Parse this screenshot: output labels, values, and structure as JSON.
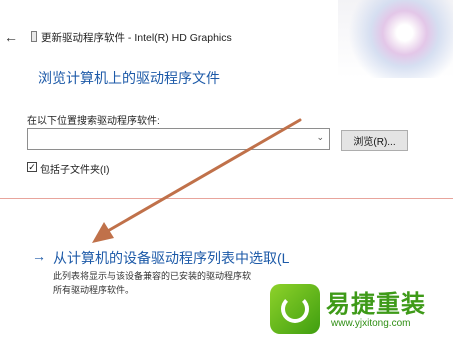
{
  "window": {
    "title": "更新驱动程序软件 - Intel(R) HD Graphics",
    "back_icon": "back-arrow-icon"
  },
  "page": {
    "heading": "浏览计算机上的驱动程序文件",
    "search_label": "在以下位置搜索驱动程序软件:",
    "path_value": "",
    "browse_label": "浏览(R)...",
    "include_subfolders_label": "包括子文件夹(I)",
    "include_subfolders_checked": true
  },
  "pick": {
    "arrow": "→",
    "link": "从计算机的设备驱动程序列表中选取(L",
    "description_line1": "此列表将显示与该设备兼容的已安装的驱动程序软",
    "description_line2": "所有驱动程序软件。"
  },
  "watermark": {
    "title": "易捷重装",
    "url": "www.yjxitong.com"
  },
  "colors": {
    "link_blue": "#1d5aa8",
    "annotation_arrow": "#c0714a",
    "logo_green": "#3e9a18"
  }
}
